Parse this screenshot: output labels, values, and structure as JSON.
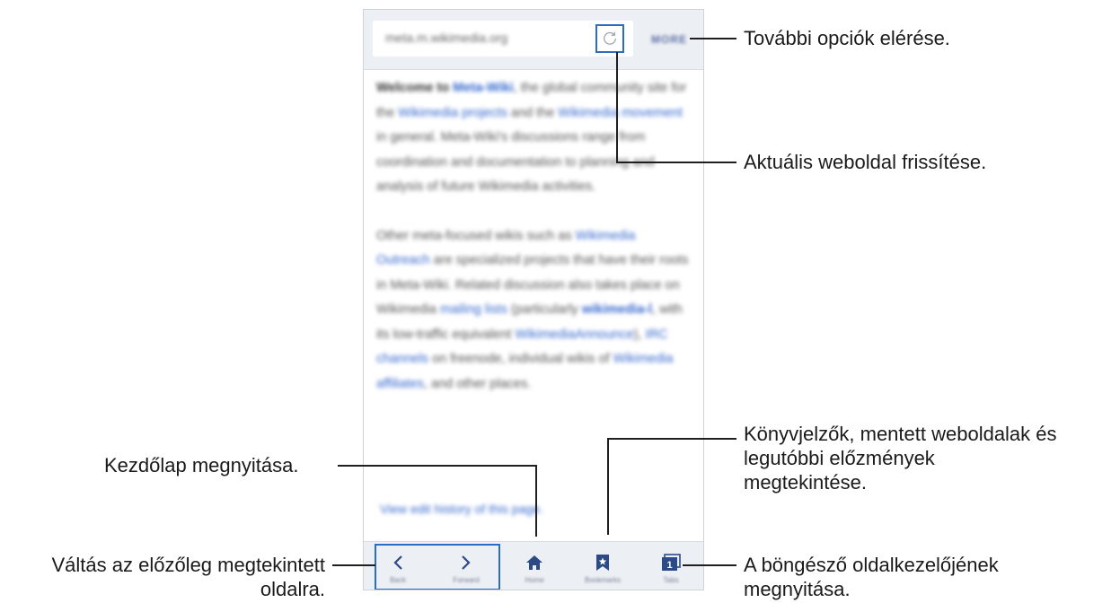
{
  "browser": {
    "url": "meta.m.wikimedia.org",
    "more_label": "MORE",
    "paragraphs": [
      [
        "Welcome to ",
        "Meta-Wiki",
        ", the global community site for the ",
        "Wikimedia projects",
        " and the ",
        "Wikimedia movement",
        " in general. Meta-Wiki's discussions range from coordination and documentation to planning and analysis of future Wikimedia activities."
      ],
      [
        "Other meta-focused wikis such as ",
        "Wikimedia Outreach",
        " are specialized projects that have their roots in Meta-Wiki. Related discussion also takes place on Wikimedia ",
        "mailing lists",
        " (particularly ",
        "wikimedia-l",
        ", with its low-traffic equivalent ",
        "WikimediaAnnounce",
        "), ",
        "IRC channels",
        " on freenode, individual wikis of ",
        "Wikimedia affiliates",
        ", and other places."
      ]
    ],
    "history_link": "View edit history of this page.",
    "toolbar": [
      {
        "icon": "back-icon",
        "label": "Back"
      },
      {
        "icon": "forward-icon",
        "label": "Forward"
      },
      {
        "icon": "home-icon",
        "label": "Home"
      },
      {
        "icon": "bookmark-icon",
        "label": "Bookmarks"
      },
      {
        "icon": "tabs-icon",
        "label": "Tabs"
      }
    ],
    "tabs_count": "1",
    "accent_color": "#2b6cc4"
  },
  "callouts": {
    "more_options": "További opciók elérése.",
    "refresh": "Aktuális weboldal frissítése.",
    "bookmarks": [
      "Könyvjelzők, mentett weboldalak és",
      "legutóbbi előzmények",
      "megtekintése."
    ],
    "home": "Kezdőlap megnyitása.",
    "navigation": [
      "Váltás az előzőleg megtekintett",
      "oldalra."
    ],
    "tab_manager": [
      "A böngésző oldalkezelőjének",
      "megnyitása."
    ]
  }
}
